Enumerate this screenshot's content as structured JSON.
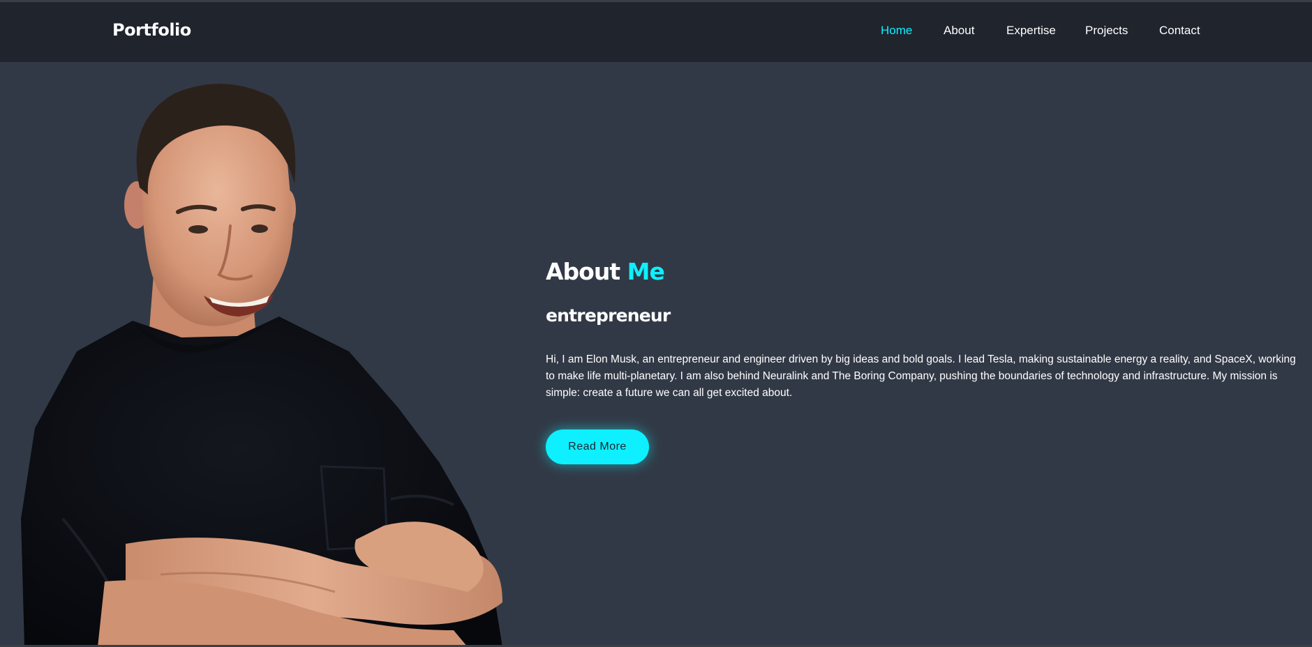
{
  "header": {
    "logo": "Portfolio",
    "nav": [
      {
        "label": "Home",
        "active": true
      },
      {
        "label": "About",
        "active": false
      },
      {
        "label": "Expertise",
        "active": false
      },
      {
        "label": "Projects",
        "active": false
      },
      {
        "label": "Contact",
        "active": false
      }
    ]
  },
  "hero": {
    "title_main": "About",
    "title_accent": "Me",
    "subtitle": "entrepreneur",
    "bio": "Hi, I am Elon Musk, an entrepreneur and engineer driven by big ideas and bold goals. I lead Tesla, making sustainable energy a reality, and SpaceX, working to make life multi-planetary. I am also behind Neuralink and The Boring Company, pushing the boundaries of technology and infrastructure. My mission is simple: create a future we can all get excited about.",
    "button_label": "Read More"
  },
  "colors": {
    "background": "#323946",
    "navbar": "#1f242d",
    "accent": "#0ef0ff",
    "text": "#ffffff"
  }
}
